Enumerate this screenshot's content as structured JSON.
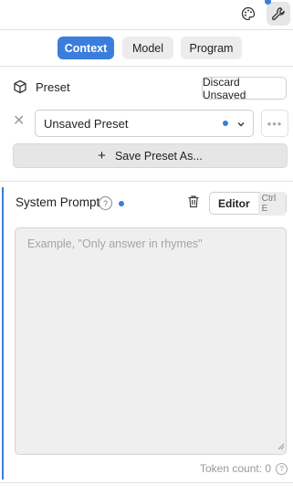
{
  "topbar": {
    "palette_icon": "palette-icon",
    "wrench_icon": "wrench-icon"
  },
  "tabs": [
    {
      "label": "Context",
      "active": true
    },
    {
      "label": "Model",
      "active": false
    },
    {
      "label": "Program",
      "active": false
    }
  ],
  "preset": {
    "label": "Preset",
    "discard_label": "Discard Unsaved",
    "selected": "Unsaved Preset",
    "more_glyph": "•••",
    "close_glyph": "✕",
    "save_label": "Save Preset As..."
  },
  "system_prompt": {
    "title": "System Prompt",
    "help_glyph": "?",
    "editor_label": "Editor",
    "editor_shortcut": "Ctrl E",
    "placeholder": "Example, \"Only answer in rhymes\"",
    "token_label": "Token count: 0"
  },
  "colors": {
    "accent": "#3b7ddd"
  }
}
